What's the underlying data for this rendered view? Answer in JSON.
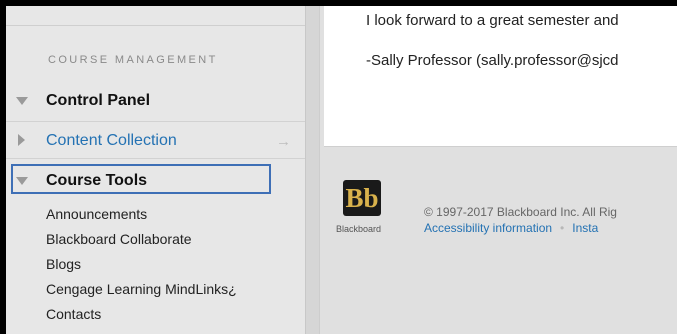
{
  "sidebar": {
    "section_title": "COURSE MANAGEMENT",
    "control_panel": "Control Panel",
    "content_collection": "Content Collection",
    "content_collection_arrow": "→",
    "course_tools": "Course Tools",
    "tools": [
      "Announcements",
      "Blackboard Collaborate",
      "Blogs",
      "Cengage Learning MindLinks¿",
      "Contacts"
    ]
  },
  "main": {
    "message_line_1": "I look forward to a great semester and",
    "message_line_2": "-Sally Professor (sally.professor@sjcd",
    "logo_mark": "Bb",
    "logo_word": "Blackboard",
    "copyright": "© 1997-2017 Blackboard Inc. All Rig",
    "footer_link_1": "Accessibility information",
    "footer_separator": "•",
    "footer_link_2": "Insta"
  },
  "colors": {
    "link": "#2472b3",
    "focus_outline": "#3e6fb6",
    "logo_gold": "#d9b24c"
  }
}
